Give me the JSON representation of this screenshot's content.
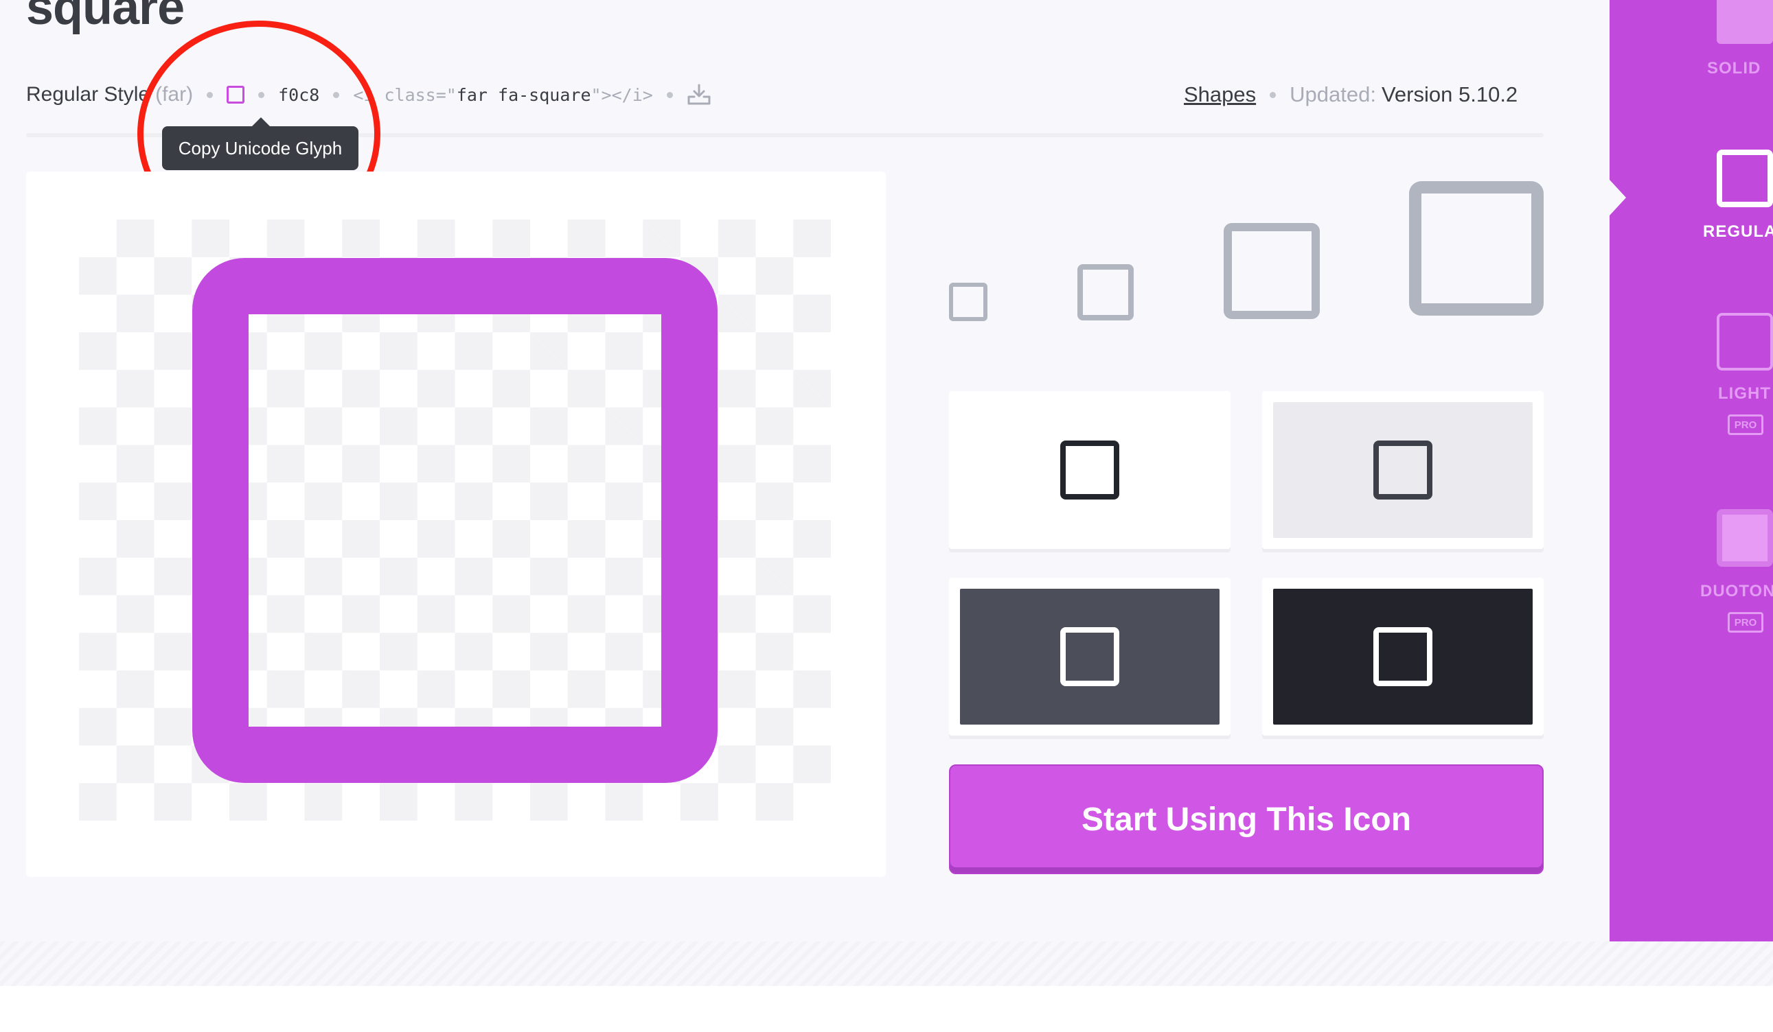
{
  "page": {
    "title": "square"
  },
  "meta": {
    "style_label": "Regular Style",
    "style_prefix": "(far)",
    "unicode": "f0c8",
    "html_open": "<i class=\"",
    "html_classes": "far fa-square",
    "html_close": "\"></i>",
    "category_link": "Shapes",
    "updated_label": "Updated:",
    "updated_version": "Version 5.10.2"
  },
  "tooltip": {
    "text": "Copy Unicode Glyph"
  },
  "cta": {
    "label": "Start Using This Icon"
  },
  "sidebar": {
    "styles": [
      {
        "label": "SOLID",
        "pro": false,
        "active": false
      },
      {
        "label": "REGULAR",
        "pro": false,
        "active": true
      },
      {
        "label": "LIGHT",
        "pro": true,
        "active": false
      },
      {
        "label": "DUOTONE",
        "pro": true,
        "active": false
      }
    ],
    "pro_label": "PRO"
  },
  "colors": {
    "brand_purple": "#c24ade",
    "cta_purple": "#d056e6",
    "annotation_red": "#f82012",
    "text_dark": "#3b3d45",
    "text_muted": "#a9acb6"
  }
}
